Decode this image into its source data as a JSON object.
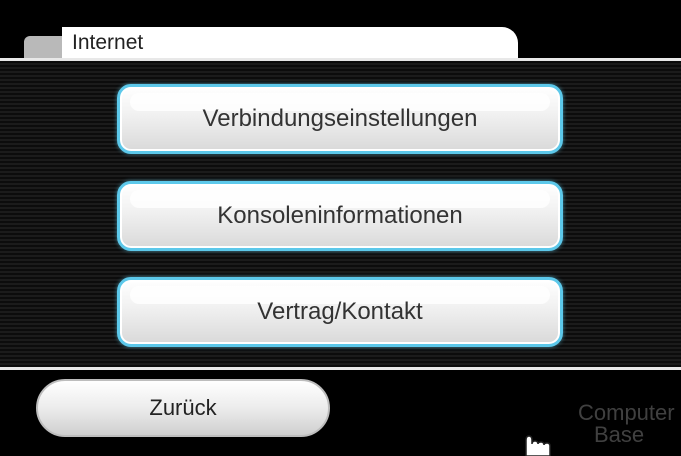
{
  "header": {
    "title": "Internet"
  },
  "menu": {
    "items": [
      {
        "label": "Verbindungseinstellungen"
      },
      {
        "label": "Konsoleninformationen"
      },
      {
        "label": "Vertrag/Kontakt"
      }
    ]
  },
  "footer": {
    "back_label": "Zurück"
  },
  "watermark": {
    "line1": "Computer",
    "line2": "Base"
  },
  "icons": {
    "pointer": "wii-hand-pointer-icon"
  },
  "colors": {
    "accent": "#5cc8ea",
    "background": "#000000",
    "button": "#f2f2f2"
  }
}
